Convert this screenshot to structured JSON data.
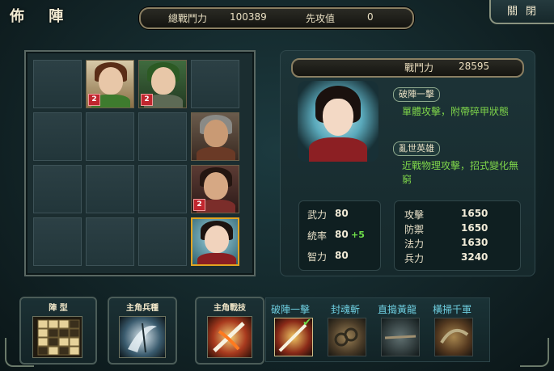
{
  "header": {
    "title": "佈 陣",
    "total_power_label": "總戰鬥力",
    "total_power_value": "100389",
    "initiative_label": "先攻值",
    "initiative_value": "0",
    "close_label": "關閉"
  },
  "formation": {
    "heroes": [
      {
        "name": "hero-girl-brown-hair",
        "level": "2",
        "hair": "#5a2d17",
        "body": "#3e7b2e"
      },
      {
        "name": "hero-green-headband",
        "level": "2",
        "hair": "#2c5a24",
        "body": "#5d6a55"
      },
      {
        "name": "hero-helmet-warrior",
        "level": "",
        "hair": "#8a8a86",
        "body": "#6a3a26"
      },
      {
        "name": "hero-dark-hair-man",
        "level": "2",
        "hair": "#241611",
        "body": "#7b2d2a"
      },
      {
        "name": "hero-main-character",
        "level": "",
        "hair": "#1d1310",
        "body": "#8a1f22"
      }
    ]
  },
  "detail": {
    "power_label": "戰鬥力",
    "power_value": "28595",
    "skill1_name": "破陣一擊",
    "skill1_desc": "單體攻擊，附帶碎甲狀態",
    "skill2_name": "亂世英雄",
    "skill2_desc": "近戰物理攻擊，招式變化無窮",
    "attrs": {
      "wuli_label": "武力",
      "wuli_value": "80",
      "tongshuai_label": "統率",
      "tongshuai_value": "80",
      "tongshuai_bonus": "+5",
      "zhili_label": "智力",
      "zhili_value": "80"
    },
    "combat": {
      "attack_label": "攻擊",
      "attack_value": "1650",
      "defense_label": "防禦",
      "defense_value": "1650",
      "magic_label": "法力",
      "magic_value": "1630",
      "troops_label": "兵力",
      "troops_value": "3240"
    }
  },
  "bottom": {
    "formation_type_label": "陣 型",
    "troop_type_label": "主角兵種",
    "battle_skill_label": "主角戰技",
    "skills": [
      "破陣一擊",
      "封魂斬",
      "直搗黃龍",
      "橫掃千軍"
    ]
  },
  "colors": {
    "accent_gold": "#e1a421",
    "skill_desc_green": "#7fd64a",
    "skill_label_cyan": "#6fd0e2"
  }
}
